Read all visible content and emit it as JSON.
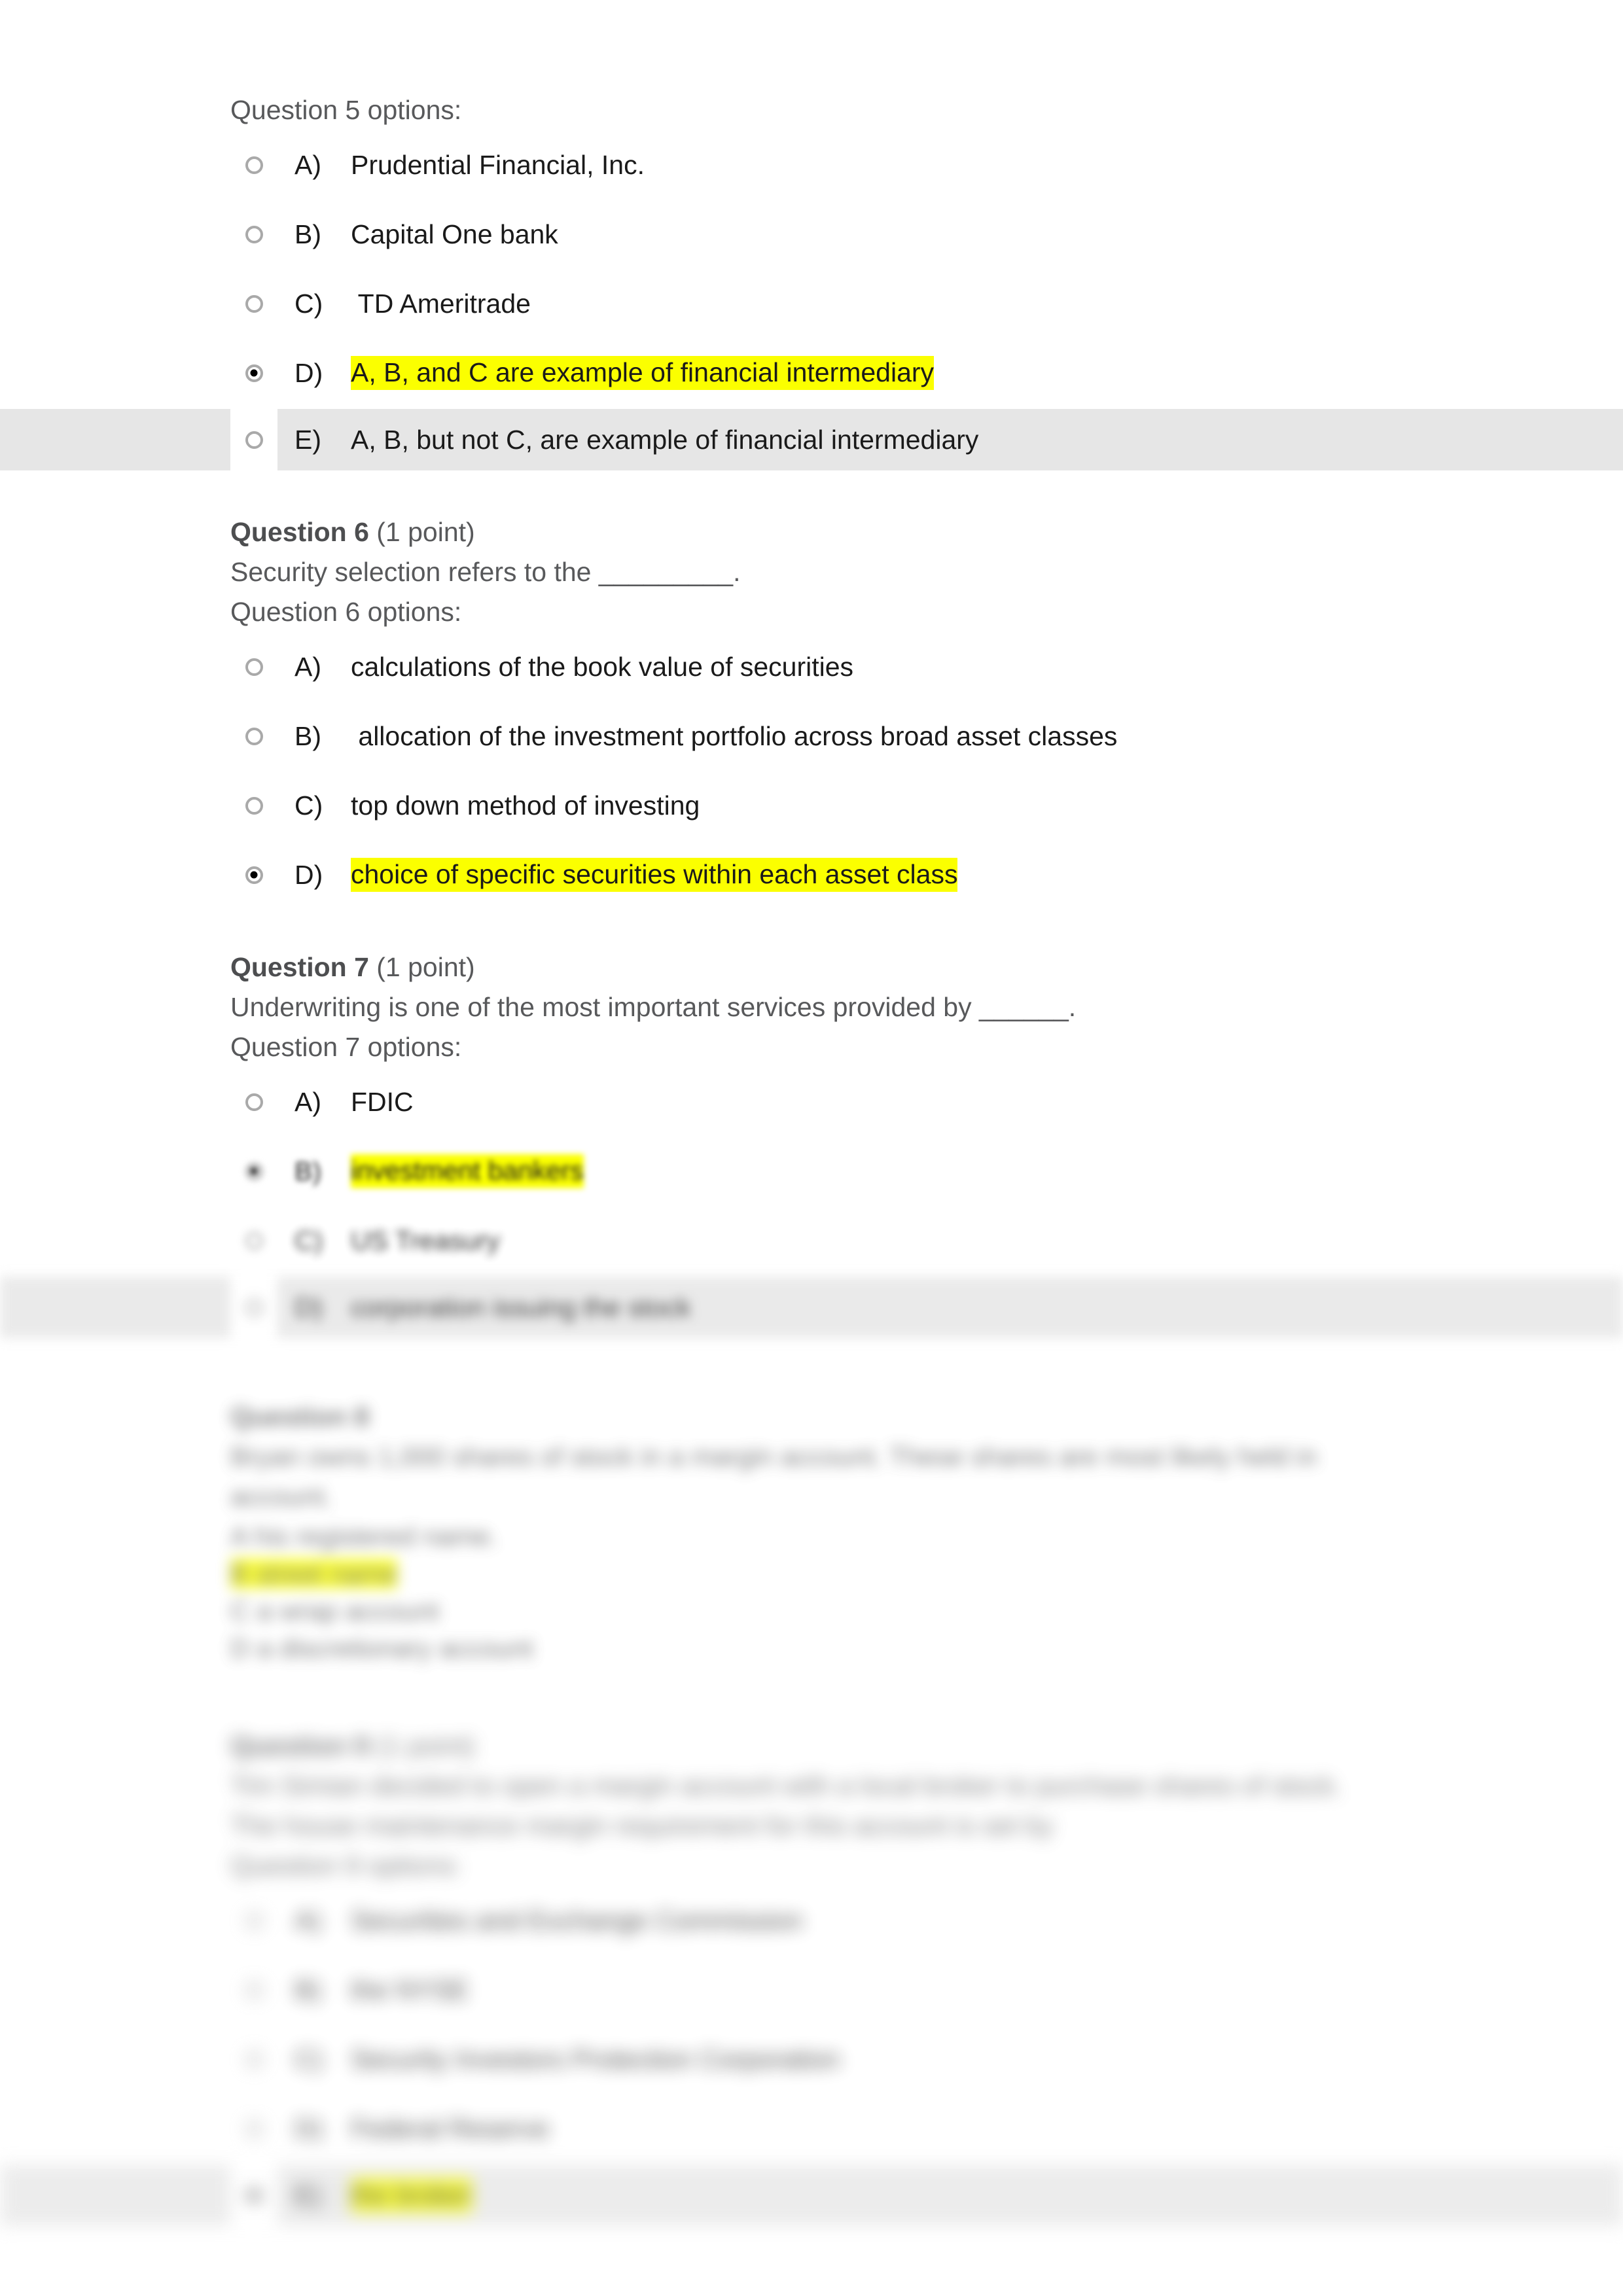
{
  "document": {
    "type": "online-quiz-printout",
    "highlight_color": "#fbff00",
    "band_color": "#e6e6e6",
    "text_color": "#58595b",
    "option_text_color": "#1a1a1a"
  },
  "question5": {
    "options_label": "Question 5 options:",
    "options": [
      {
        "letter": "A)",
        "text": "Prudential Financial, Inc.",
        "selected": false,
        "highlighted": false,
        "banded": false
      },
      {
        "letter": "B)",
        "text": "Capital One bank",
        "selected": false,
        "highlighted": false,
        "banded": false
      },
      {
        "letter": "C)",
        "text": " TD Ameritrade",
        "selected": false,
        "highlighted": false,
        "banded": false
      },
      {
        "letter": "D)",
        "text": "A, B, and C are example of financial intermediary",
        "selected": true,
        "highlighted": true,
        "banded": false
      },
      {
        "letter": "E)",
        "text": "A, B, but not C, are example of financial intermediary",
        "selected": false,
        "highlighted": false,
        "banded": true
      }
    ]
  },
  "question6": {
    "header_bold": "Question 6",
    "header_points": " (1 point)",
    "prompt": "Security selection refers to the _________.",
    "options_label": "Question 6 options:",
    "options": [
      {
        "letter": "A)",
        "text": "calculations of the book value of securities",
        "selected": false,
        "highlighted": false,
        "banded": false
      },
      {
        "letter": "B)",
        "text": " allocation of the investment portfolio across broad asset classes",
        "selected": false,
        "highlighted": false,
        "banded": false
      },
      {
        "letter": "C)",
        "text": "top down method of investing",
        "selected": false,
        "highlighted": false,
        "banded": false
      },
      {
        "letter": "D)",
        "text": "choice of specific securities within each asset class",
        "selected": true,
        "highlighted": true,
        "banded": false
      }
    ]
  },
  "question7": {
    "header_bold": "Question 7",
    "header_points": " (1 point)",
    "prompt": "Underwriting is one of the most important services provided by ______.",
    "options_label": "Question 7 options:",
    "options": [
      {
        "letter": "A)",
        "text": "FDIC",
        "selected": false,
        "highlighted": false,
        "banded": false
      },
      {
        "letter": "B)",
        "text": "investment bankers",
        "selected": true,
        "highlighted": true,
        "banded": false
      },
      {
        "letter": "C)",
        "text": "US Treasury",
        "selected": false,
        "highlighted": false,
        "banded": false
      },
      {
        "letter": "D)",
        "text": "corporation issuing the stock",
        "selected": false,
        "highlighted": false,
        "banded": true
      }
    ]
  },
  "question8": {
    "header_bold": "Question 8",
    "prompt_line1": "Bryan owns 1,000 shares of stock in a margin account. These shares are most likely held in",
    "prompt_line2": "account.",
    "options": [
      {
        "text": "A his registered name.",
        "highlighted": false
      },
      {
        "text": "B street name",
        "highlighted": true
      },
      {
        "text": "C a wrap account",
        "highlighted": false
      },
      {
        "text": "D a discretionary account",
        "highlighted": false
      }
    ]
  },
  "question9": {
    "header_bold": "Question 9",
    "header_points": " (1 point)",
    "prompt_line1": "Tim Simian decided to open a margin account with a local broker to purchase shares of stock.",
    "prompt_line2": "The house maintenance margin requirement for this account is set by",
    "options_label": "Question 9 options:",
    "options": [
      {
        "letter": "A)",
        "text": "Securities and Exchange Commission",
        "selected": false,
        "highlighted": false,
        "banded": false
      },
      {
        "letter": "B)",
        "text": "the NYSE",
        "selected": false,
        "highlighted": false,
        "banded": false
      },
      {
        "letter": "C)",
        "text": "Security Investors Protection Corporation",
        "selected": false,
        "highlighted": false,
        "banded": false
      },
      {
        "letter": "D)",
        "text": "Federal Reserve",
        "selected": false,
        "highlighted": false,
        "banded": false
      },
      {
        "letter": "E)",
        "text": "the broker",
        "selected": true,
        "highlighted": true,
        "banded": true
      }
    ]
  }
}
